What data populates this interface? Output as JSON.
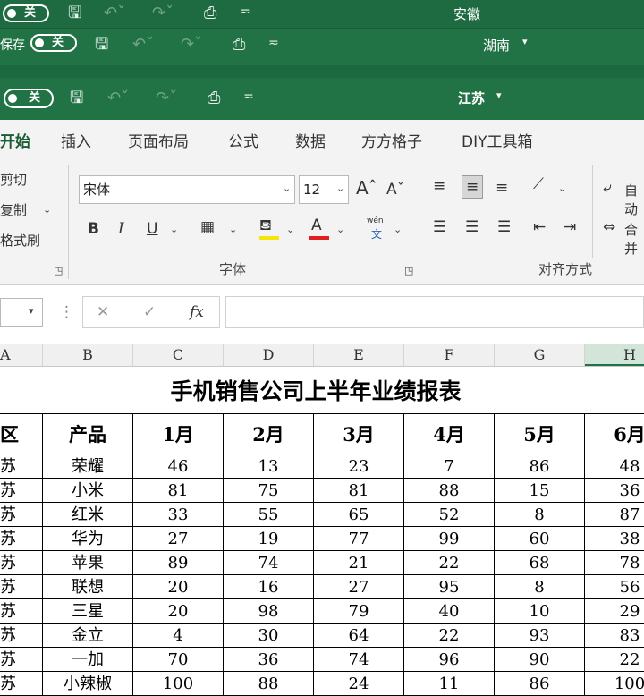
{
  "windows": [
    {
      "toggle": "关",
      "title": "安徽"
    },
    {
      "autosave": "保存",
      "toggle": "关",
      "title": "湖南"
    },
    {
      "toggle": "关",
      "title": "江苏"
    }
  ],
  "ribbon_tabs": [
    "开始",
    "插入",
    "页面布局",
    "公式",
    "数据",
    "方方格子",
    "DIY工具箱"
  ],
  "clipboard": {
    "cut": "剪切",
    "copy": "复制",
    "format_painter": "格式刷"
  },
  "font": {
    "name": "宋体",
    "size": "12",
    "group_label": "字体",
    "bold": "B",
    "italic": "I",
    "underline": "U",
    "color_a": "A",
    "pinyin": "wén"
  },
  "alignment": {
    "group_label": "对齐方式",
    "wrap": "自动",
    "merge": "合并"
  },
  "formula_bar": {
    "fx": "fx"
  },
  "column_headers": [
    "A",
    "B",
    "C",
    "D",
    "E",
    "F",
    "G",
    "H"
  ],
  "sheet": {
    "title": "手机销售公司上半年业绩报表",
    "headers": [
      "区",
      "产品",
      "1月",
      "2月",
      "3月",
      "4月",
      "5月",
      "6月"
    ],
    "rows": [
      [
        "苏",
        "荣耀",
        "46",
        "13",
        "23",
        "7",
        "86",
        "48"
      ],
      [
        "苏",
        "小米",
        "81",
        "75",
        "81",
        "88",
        "15",
        "36"
      ],
      [
        "苏",
        "红米",
        "33",
        "55",
        "65",
        "52",
        "8",
        "87"
      ],
      [
        "苏",
        "华为",
        "27",
        "19",
        "77",
        "99",
        "60",
        "38"
      ],
      [
        "苏",
        "苹果",
        "89",
        "74",
        "21",
        "22",
        "68",
        "78"
      ],
      [
        "苏",
        "联想",
        "20",
        "16",
        "27",
        "95",
        "8",
        "56"
      ],
      [
        "苏",
        "三星",
        "20",
        "98",
        "79",
        "40",
        "10",
        "29"
      ],
      [
        "苏",
        "金立",
        "4",
        "30",
        "64",
        "22",
        "93",
        "83"
      ],
      [
        "苏",
        "一加",
        "70",
        "36",
        "74",
        "96",
        "90",
        "22"
      ],
      [
        "苏",
        "小辣椒",
        "100",
        "88",
        "24",
        "11",
        "86",
        "100"
      ]
    ]
  },
  "colors": {
    "excel_green": "#217346",
    "title_green": "#1e6b41",
    "ribbon_bg": "#f3f3f3"
  }
}
